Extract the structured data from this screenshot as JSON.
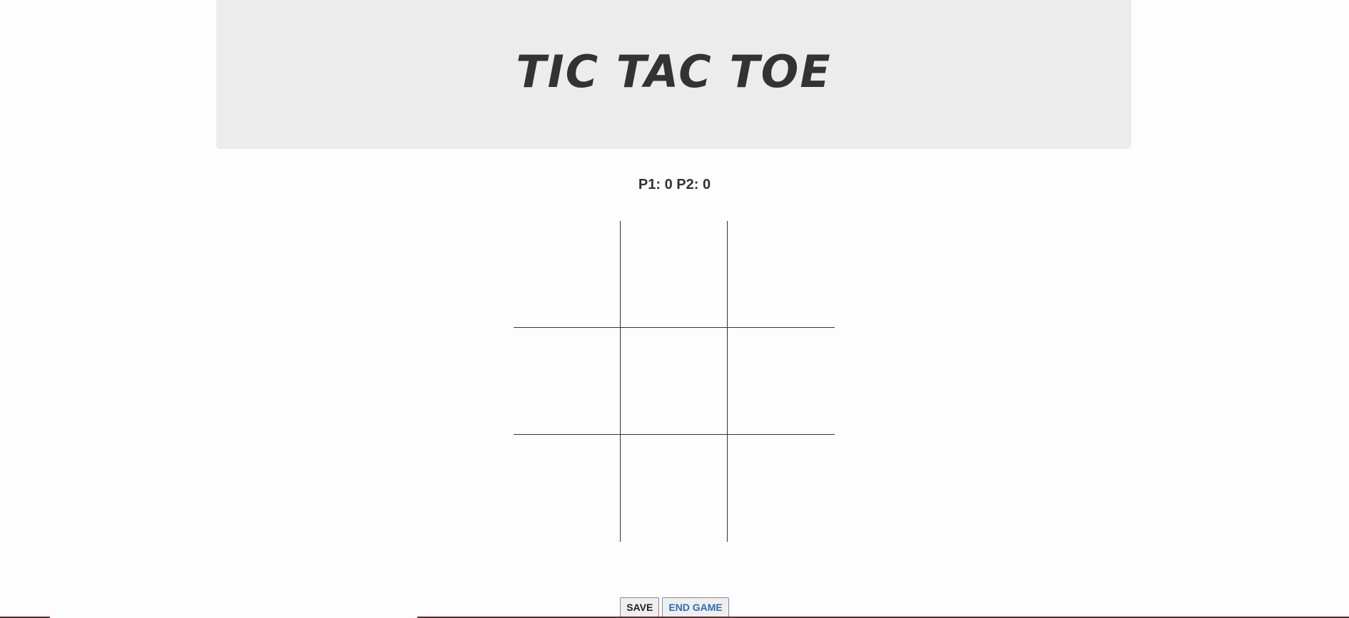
{
  "header": {
    "title": "TIC TAC TOE"
  },
  "score": {
    "text": "P1: 0 P2: 0"
  },
  "board": {
    "cells": [
      "",
      "",
      "",
      "",
      "",
      "",
      "",
      "",
      ""
    ]
  },
  "controls": {
    "save_label": "SAVE",
    "end_label": "END GAME"
  },
  "colors": {
    "header_bg": "#ececec",
    "text": "#333333",
    "end_button_text": "#2b6fb6"
  }
}
